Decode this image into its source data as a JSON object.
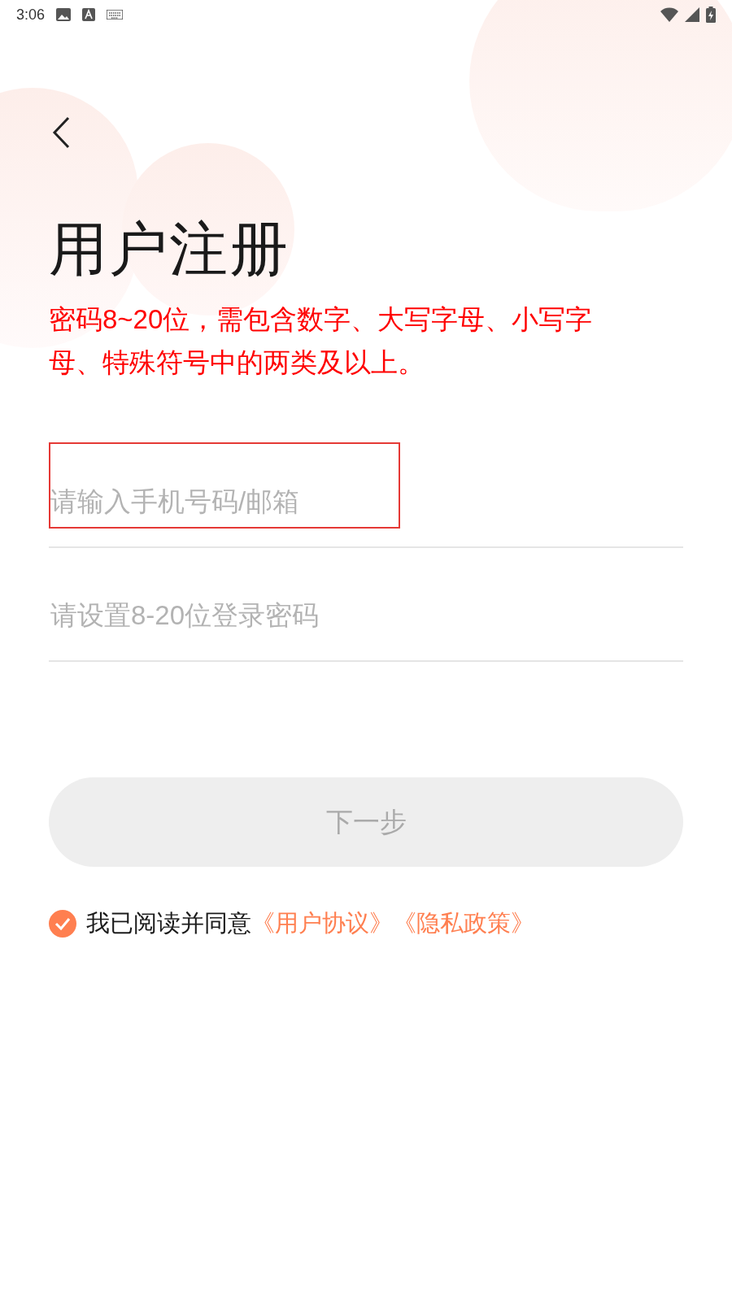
{
  "status_bar": {
    "time": "3:06"
  },
  "title": "用户注册",
  "hint": "密码8~20位，需包含数字、大写字母、小写字母、特殊符号中的两类及以上。",
  "fields": [
    {
      "placeholder": "请输入手机号码/邮箱",
      "highlighted": true
    },
    {
      "placeholder": "请设置8-20位登录密码",
      "highlighted": false
    }
  ],
  "next_button": {
    "label": "下一步",
    "disabled": true
  },
  "agreement": {
    "checked": true,
    "text": "我已阅读并同意",
    "links": [
      "《用户协议》",
      "《隐私政策》"
    ]
  }
}
